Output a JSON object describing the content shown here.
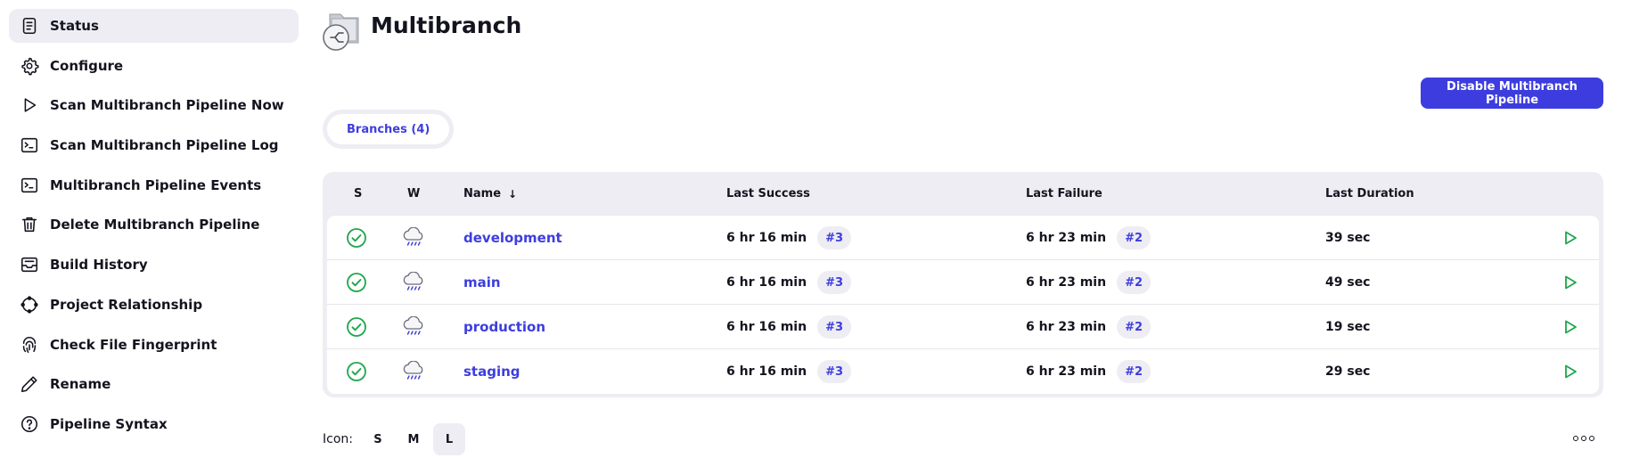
{
  "sidebar": {
    "items": [
      {
        "label": "Status",
        "icon": "status-doc-icon",
        "active": true
      },
      {
        "label": "Configure",
        "icon": "gear-icon"
      },
      {
        "label": "Scan Multibranch Pipeline Now",
        "icon": "play-icon"
      },
      {
        "label": "Scan Multibranch Pipeline Log",
        "icon": "terminal-icon"
      },
      {
        "label": "Multibranch Pipeline Events",
        "icon": "terminal-icon"
      },
      {
        "label": "Delete Multibranch Pipeline",
        "icon": "trash-icon"
      },
      {
        "label": "Build History",
        "icon": "inbox-icon"
      },
      {
        "label": "Project Relationship",
        "icon": "relationship-icon"
      },
      {
        "label": "Check File Fingerprint",
        "icon": "fingerprint-icon"
      },
      {
        "label": "Rename",
        "icon": "pencil-icon"
      },
      {
        "label": "Pipeline Syntax",
        "icon": "help-circle-icon"
      }
    ]
  },
  "header": {
    "title": "Multibranch",
    "job_icon": "multibranch-folder-icon"
  },
  "actions": {
    "disable_label": "Disable Multibranch Pipeline"
  },
  "tabs": [
    {
      "label": "Branches (4)",
      "active": true
    }
  ],
  "table": {
    "headers": {
      "s": "S",
      "w": "W",
      "name": "Name",
      "name_sort": "↓",
      "last_success": "Last Success",
      "last_failure": "Last Failure",
      "last_duration": "Last Duration"
    },
    "rows": [
      {
        "status": "success-icon",
        "weather": "rain-cloud-icon",
        "name": "development",
        "last_success": "6 hr 16 min",
        "success_build": "#3",
        "last_failure": "6 hr 23 min",
        "failure_build": "#2",
        "duration": "39 sec"
      },
      {
        "status": "success-icon",
        "weather": "rain-cloud-icon",
        "name": "main",
        "last_success": "6 hr 16 min",
        "success_build": "#3",
        "last_failure": "6 hr 23 min",
        "failure_build": "#2",
        "duration": "49 sec"
      },
      {
        "status": "success-icon",
        "weather": "rain-cloud-icon",
        "name": "production",
        "last_success": "6 hr 16 min",
        "success_build": "#3",
        "last_failure": "6 hr 23 min",
        "failure_build": "#2",
        "duration": "19 sec"
      },
      {
        "status": "success-icon",
        "weather": "rain-cloud-icon",
        "name": "staging",
        "last_success": "6 hr 16 min",
        "success_build": "#3",
        "last_failure": "6 hr 23 min",
        "failure_build": "#2",
        "duration": "29 sec"
      }
    ]
  },
  "icon_size": {
    "label": "Icon:",
    "options": [
      "S",
      "M",
      "L"
    ],
    "selected": "L"
  },
  "colors": {
    "accent": "#3d3ddf",
    "success": "#1ea64b",
    "surface": "#ededf3"
  }
}
